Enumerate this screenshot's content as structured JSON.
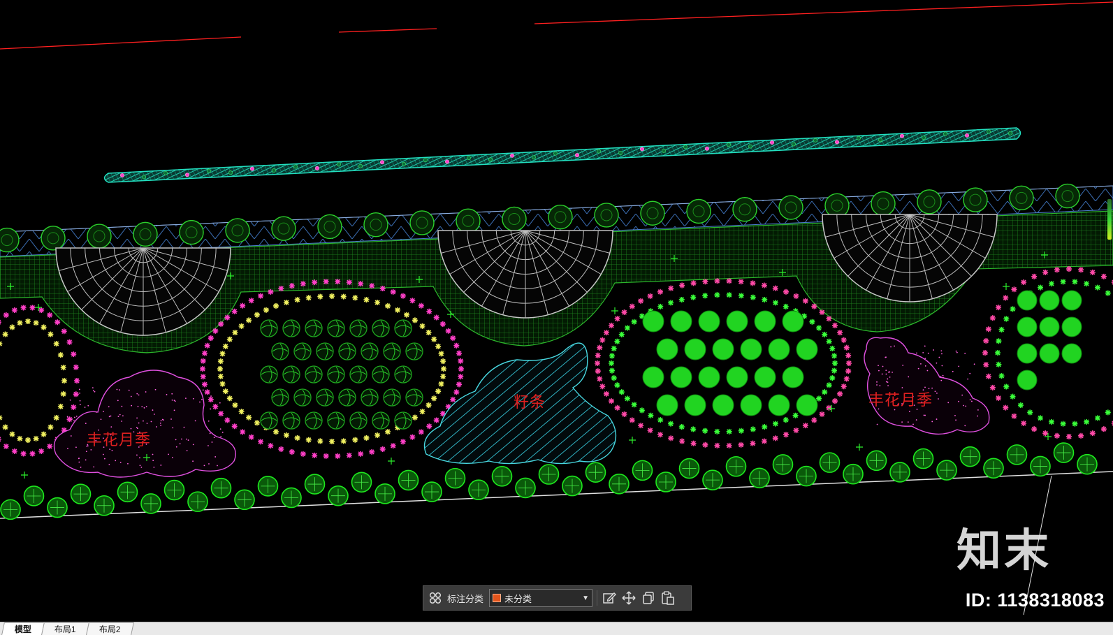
{
  "drawing": {
    "labels": {
      "rose_left": "丰花月季",
      "shrub_center": "籽条",
      "rose_right": "丰花月季"
    },
    "colors": {
      "background": "#000000",
      "boundary_line": "#ff2020",
      "hedge_green": "#1ee81e",
      "teal_hatch": "#18c8a8",
      "magenta_flower": "#ff40c8",
      "yellow_flower": "#f0f060",
      "plaza_grid": "#1e7a1e",
      "label_red": "#e02020"
    }
  },
  "watermark": {
    "logo": "知末",
    "id_text": "ID: 1138318083"
  },
  "toolbar": {
    "category_label": "标注分类",
    "selected_category": "未分类",
    "icons": {
      "layout": "grid-icon",
      "edit": "edit-icon",
      "move": "move-icon",
      "copy": "copy-icon",
      "paste": "paste-icon"
    }
  },
  "tabs": [
    {
      "label": "模型",
      "active": true
    },
    {
      "label": "布局1",
      "active": false
    },
    {
      "label": "布局2",
      "active": false
    }
  ]
}
